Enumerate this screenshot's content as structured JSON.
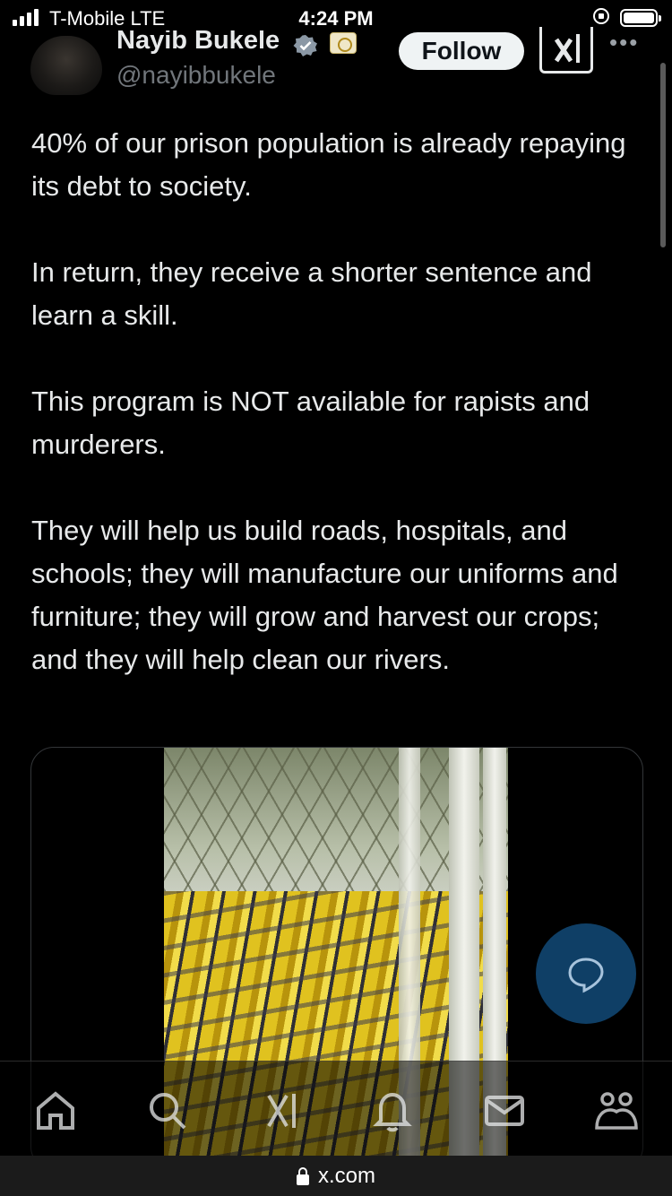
{
  "status_bar": {
    "carrier": "T-Mobile  LTE",
    "time": "4:24 PM"
  },
  "tweet": {
    "display_name": "Nayib Bukele",
    "handle": "@nayibbukele",
    "follow_label": "Follow",
    "paragraphs": [
      "40% of our prison population is already repaying its debt to society.",
      "In return, they receive a shorter sentence and learn a skill.",
      "This program is NOT available for rapists and murderers.",
      "They will help us build roads, hospitals, and schools; they will manufacture our uniforms and furniture; they will grow and harvest our crops; and they will help clean our rivers."
    ],
    "media": {
      "kind": "photo"
    }
  },
  "icons": {
    "verified": "verified-badge-icon",
    "affiliation": "government-affiliation-icon",
    "grok": "grok-icon",
    "more": "more-options-icon",
    "compose": "reply-compose-icon",
    "nav": [
      "home-icon",
      "search-icon",
      "grok-icon",
      "notifications-icon",
      "messages-icon",
      "communities-icon"
    ]
  },
  "colors": {
    "background": "#000000",
    "text": "#e7e9ea",
    "secondary_text": "#71767b",
    "accent": "#1d9bf0"
  },
  "browser": {
    "url": "x.com"
  }
}
